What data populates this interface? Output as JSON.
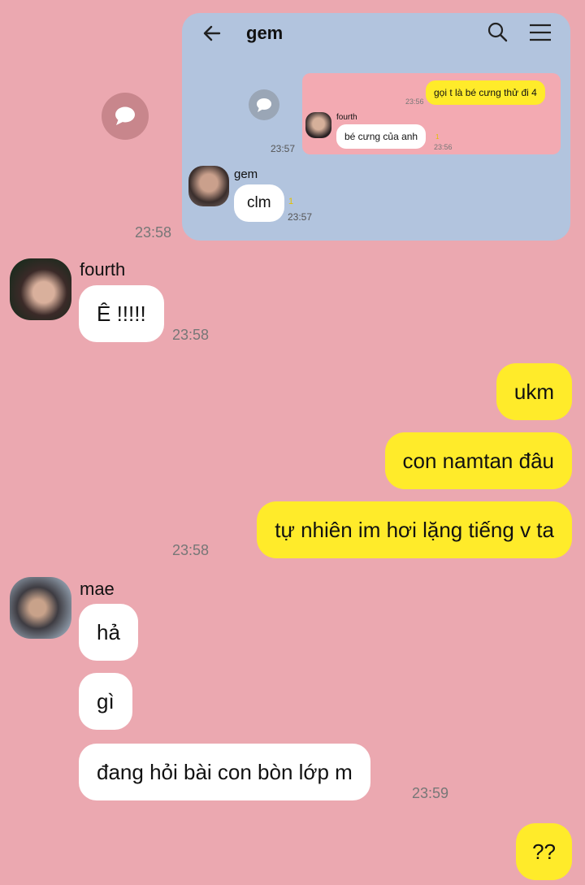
{
  "screenshot": {
    "header": {
      "back_icon": "arrow-left-icon",
      "title": "gem",
      "search_icon": "search-icon",
      "menu_icon": "menu-icon"
    },
    "inner_reply": {
      "my_message": "gọi t là bé cưng thử đi 4",
      "my_time": "23:56",
      "sender": "fourth",
      "reply_message": "bé cưng của anh",
      "reply_time": "23:56",
      "read_count": "1",
      "left_time": "23:57"
    },
    "gem_sender": "gem",
    "gem_message": "clm",
    "gem_read": "1",
    "gem_time": "23:57"
  },
  "shared_time": "23:58",
  "fourth": {
    "name": "fourth",
    "messages": [
      "Ê !!!!!"
    ],
    "time": "23:58"
  },
  "me_1": {
    "messages": [
      "ukm",
      "con namtan đâu",
      "tự nhiên im hơi lặng tiếng v ta"
    ],
    "time": "23:58"
  },
  "mae": {
    "name": "mae",
    "messages": [
      "hả",
      "gì",
      "đang hỏi bài con bòn lớp m"
    ],
    "time": "23:59"
  },
  "me_2": {
    "messages": [
      "??"
    ]
  },
  "colors": {
    "background": "#eba8b0",
    "my_bubble": "#ffeb2a",
    "their_bubble": "#ffffff",
    "embedded_bg": "#b2c4de"
  }
}
